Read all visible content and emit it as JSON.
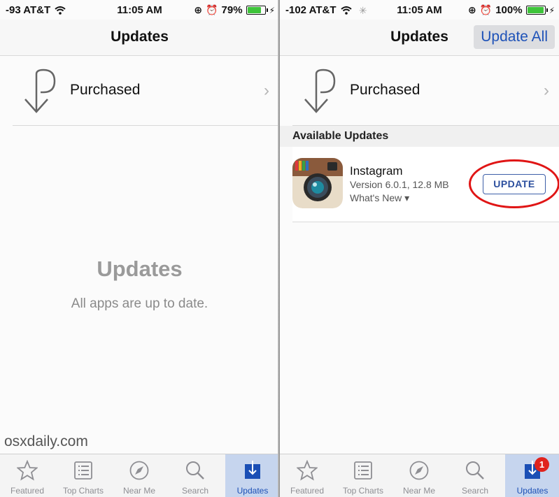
{
  "left_screen": {
    "status": {
      "carrier": "-93 AT&T",
      "time": "11:05 AM",
      "battery": "79%",
      "battery_level": 0.79
    },
    "nav_title": "Updates",
    "purchased_label": "Purchased",
    "empty_title": "Updates",
    "empty_subtitle": "All apps are up to date.",
    "watermark": "osxdaily.com"
  },
  "right_screen": {
    "status": {
      "carrier": "-102 AT&T",
      "time": "11:05 AM",
      "battery": "100%",
      "battery_level": 1.0
    },
    "nav_title": "Updates",
    "update_all_label": "Update All",
    "purchased_label": "Purchased",
    "section_header": "Available Updates",
    "app": {
      "name": "Instagram",
      "version": "Version 6.0.1, 12.8 MB",
      "whats_new": "What's New ▾",
      "button_label": "UPDATE"
    }
  },
  "tabbar": {
    "tabs": [
      {
        "label": "Featured",
        "icon": "star-icon"
      },
      {
        "label": "Top Charts",
        "icon": "list-icon"
      },
      {
        "label": "Near Me",
        "icon": "compass-icon"
      },
      {
        "label": "Search",
        "icon": "search-icon"
      },
      {
        "label": "Updates",
        "icon": "download-icon"
      }
    ],
    "active": "Updates",
    "updates_badge_right": "1"
  },
  "colors": {
    "accent": "#1e52b8",
    "highlight_ring": "#e01515",
    "badge": "#e0231d",
    "battery_green": "#3ec43a"
  }
}
